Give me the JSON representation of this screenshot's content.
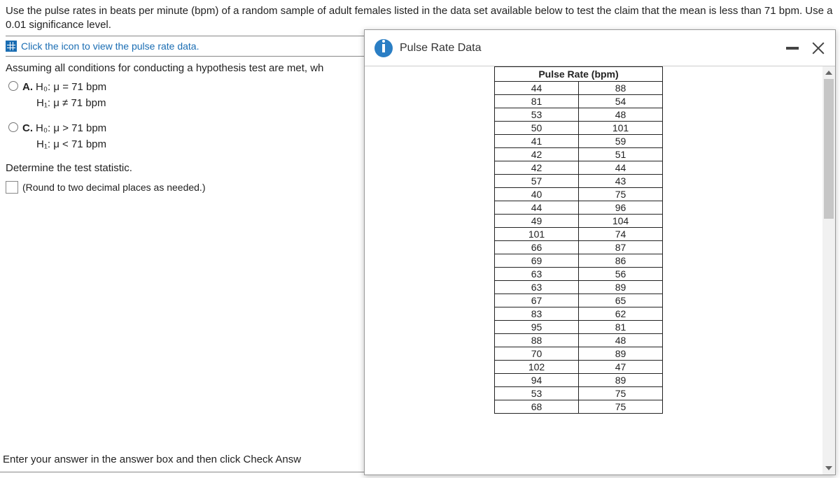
{
  "question": {
    "text": "Use the pulse rates in beats per minute (bpm) of a random sample of adult females listed in the data set available below to test the claim that the mean is less than 71 bpm. Use a 0.01 significance level.",
    "link_label": "Click the icon to view the pulse rate data.",
    "assume": "Assuming all conditions for conducting a hypothesis test are met, wh",
    "options": {
      "A": {
        "h0": "H₀: μ = 71 bpm",
        "h1": "H₁: μ ≠ 71 bpm"
      },
      "C": {
        "h0": "H₀: μ > 71 bpm",
        "h1": "H₁: μ < 71 bpm"
      }
    },
    "determine": "Determine the test statistic.",
    "round_note": "(Round to two decimal places as needed.)",
    "footer": "Enter your answer in the answer box and then click Check Answ"
  },
  "modal": {
    "title": "Pulse Rate Data",
    "table_header": "Pulse Rate (bpm)",
    "rows": [
      [
        44,
        88
      ],
      [
        81,
        54
      ],
      [
        53,
        48
      ],
      [
        50,
        101
      ],
      [
        41,
        59
      ],
      [
        42,
        51
      ],
      [
        42,
        44
      ],
      [
        57,
        43
      ],
      [
        40,
        75
      ],
      [
        44,
        96
      ],
      [
        49,
        104
      ],
      [
        101,
        74
      ],
      [
        66,
        87
      ],
      [
        69,
        86
      ],
      [
        63,
        56
      ],
      [
        63,
        89
      ],
      [
        67,
        65
      ],
      [
        83,
        62
      ],
      [
        95,
        81
      ],
      [
        88,
        48
      ],
      [
        70,
        89
      ],
      [
        102,
        47
      ],
      [
        94,
        89
      ],
      [
        53,
        75
      ],
      [
        68,
        75
      ]
    ]
  }
}
